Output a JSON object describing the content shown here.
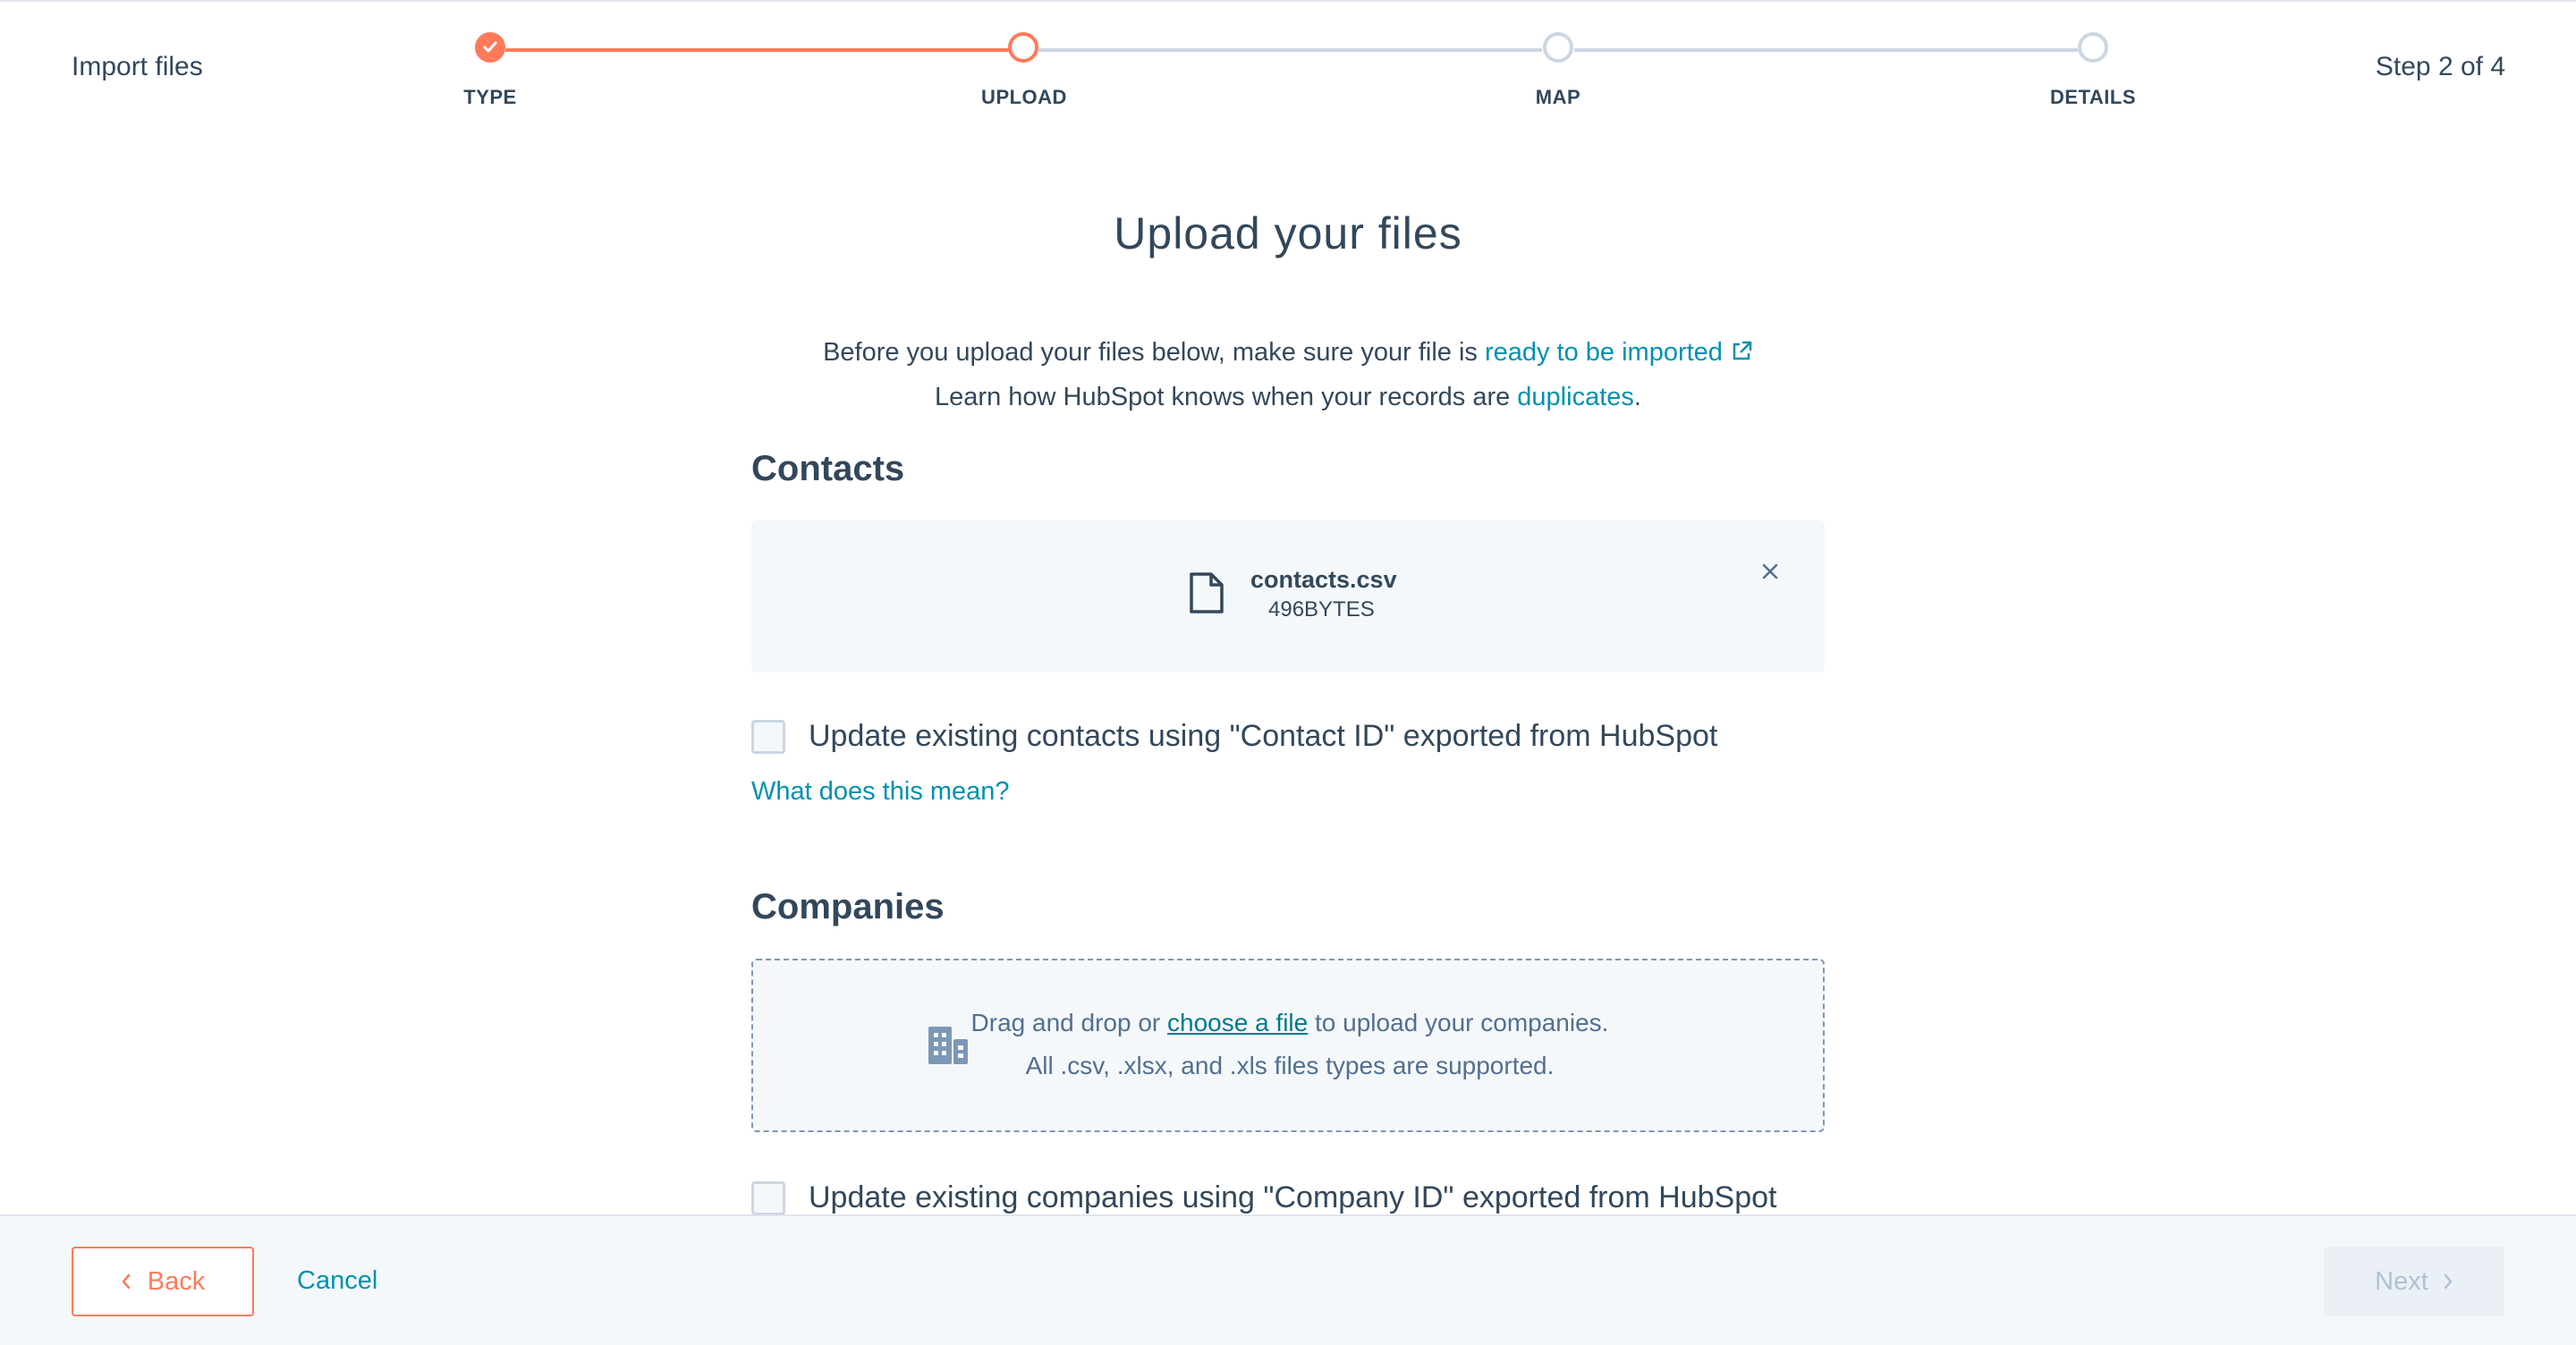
{
  "header": {
    "title": "Import files",
    "step_count": "Step 2 of 4",
    "steps": [
      {
        "label": "TYPE",
        "state": "complete"
      },
      {
        "label": "UPLOAD",
        "state": "current"
      },
      {
        "label": "MAP",
        "state": "upcoming"
      },
      {
        "label": "DETAILS",
        "state": "upcoming"
      }
    ]
  },
  "main": {
    "title": "Upload your files",
    "intro_line1_prefix": "Before you upload your files below, make sure your file is ",
    "intro_line1_link": "ready to be imported",
    "intro_line2_prefix": "Learn how HubSpot knows when your records are ",
    "intro_line2_link": "duplicates",
    "intro_line2_suffix": ".",
    "contacts": {
      "title": "Contacts",
      "file_name": "contacts.csv",
      "file_size": "496BYTES",
      "checkbox_label": "Update existing contacts using \"Contact ID\" exported from HubSpot",
      "checkbox_checked": false,
      "help_link": "What does this mean?"
    },
    "companies": {
      "title": "Companies",
      "drop_prefix": "Drag and drop or ",
      "drop_link": "choose a file",
      "drop_suffix": " to upload your companies.",
      "drop_formats": "All .csv, .xlsx, and .xls files types are supported.",
      "checkbox_label": "Update existing companies using \"Company ID\" exported from HubSpot",
      "checkbox_checked": false
    }
  },
  "footer": {
    "back_label": "Back",
    "cancel_label": "Cancel",
    "next_label": "Next",
    "next_disabled": true
  },
  "colors": {
    "accent": "#ff7a59",
    "link": "#0091ae",
    "text": "#33475b",
    "track": "#cbd6e2"
  },
  "icons": [
    "check-icon",
    "external-link-icon",
    "file-icon",
    "close-icon",
    "company-building-icon",
    "chevron-left-icon",
    "chevron-right-icon"
  ]
}
